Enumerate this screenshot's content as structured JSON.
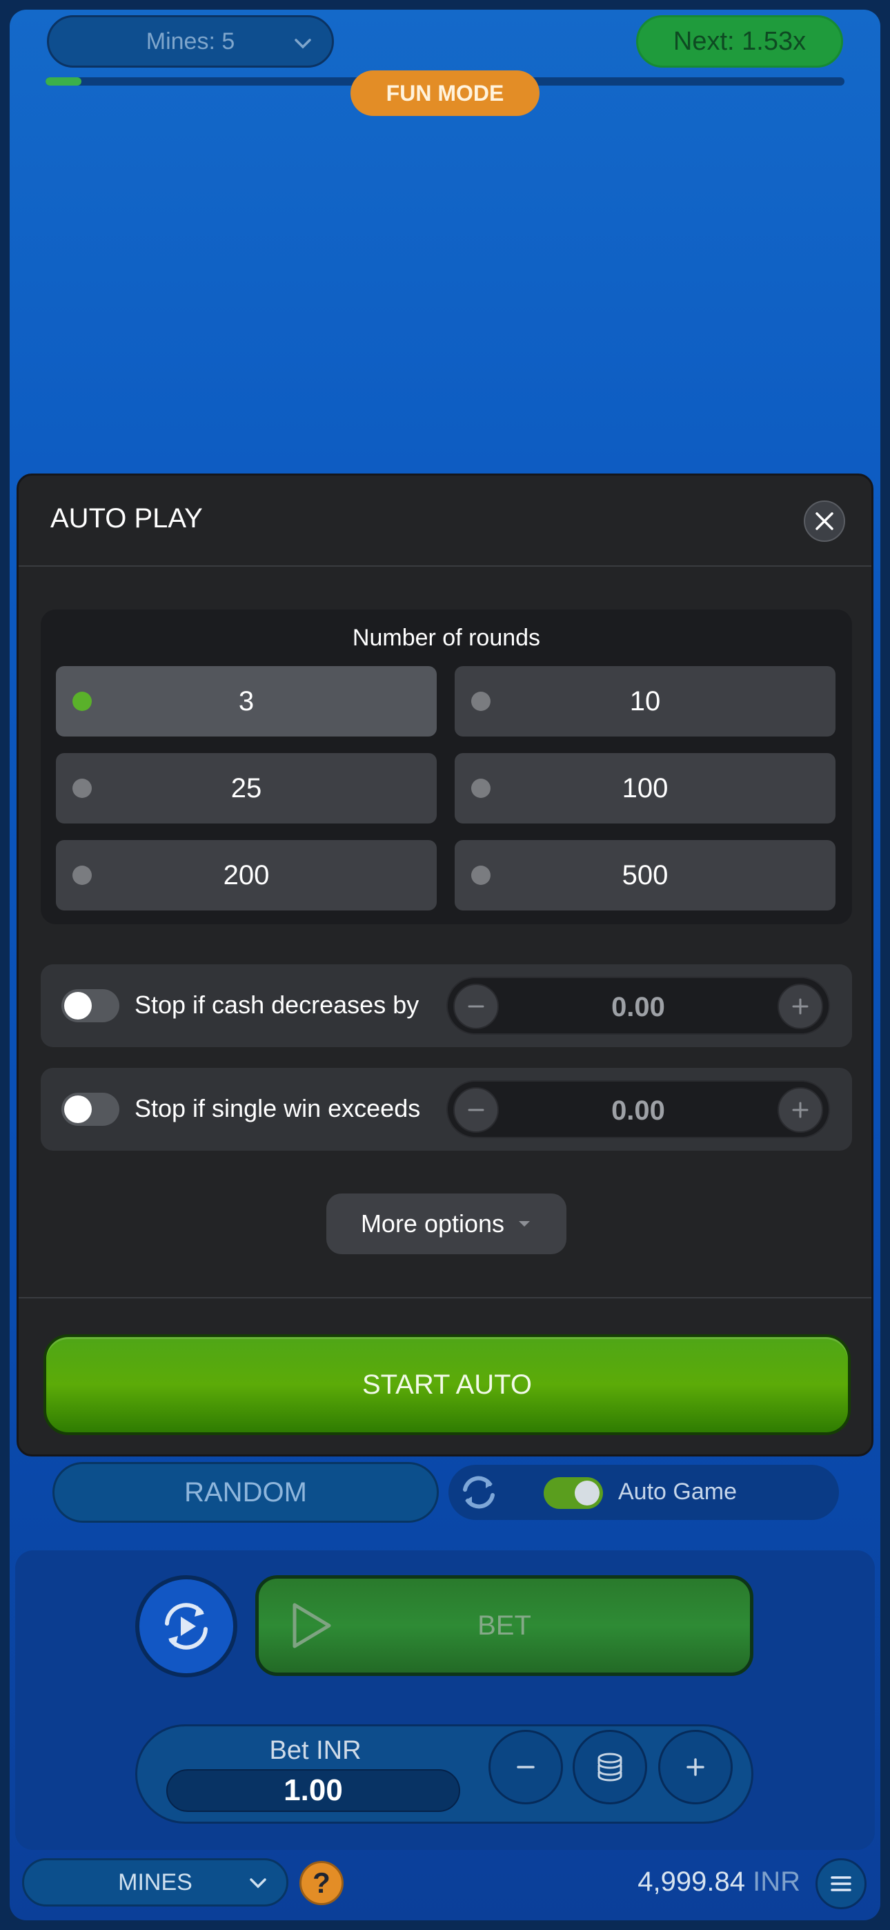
{
  "header": {
    "mines_label": "Mines: 5",
    "next_label": "Next:",
    "next_value": "1.53x",
    "progress": 0.045,
    "fun_mode": "FUN MODE"
  },
  "auto_play": {
    "title": "AUTO PLAY",
    "rounds_title": "Number of rounds",
    "rounds": [
      "3",
      "10",
      "25",
      "100",
      "200",
      "500"
    ],
    "selected_round": "3",
    "stop_cash_decreases": {
      "label": "Stop if cash decreases by",
      "value": "0.00",
      "enabled": false
    },
    "stop_single_win": {
      "label": "Stop if single win exceeds",
      "value": "0.00",
      "enabled": false
    },
    "more_options": "More options",
    "start_auto": "START AUTO"
  },
  "controls": {
    "random": "RANDOM",
    "auto_game": "Auto Game",
    "auto_game_enabled": true,
    "bet": "BET",
    "bet_label": "Bet INR",
    "bet_value": "1.00"
  },
  "footer": {
    "game_select": "MINES",
    "balance": "4,999.84",
    "currency": "INR"
  },
  "colors": {
    "accent_green": "#5cab08",
    "fun_mode_orange": "#e38d26",
    "panel_bg": "#232426"
  }
}
